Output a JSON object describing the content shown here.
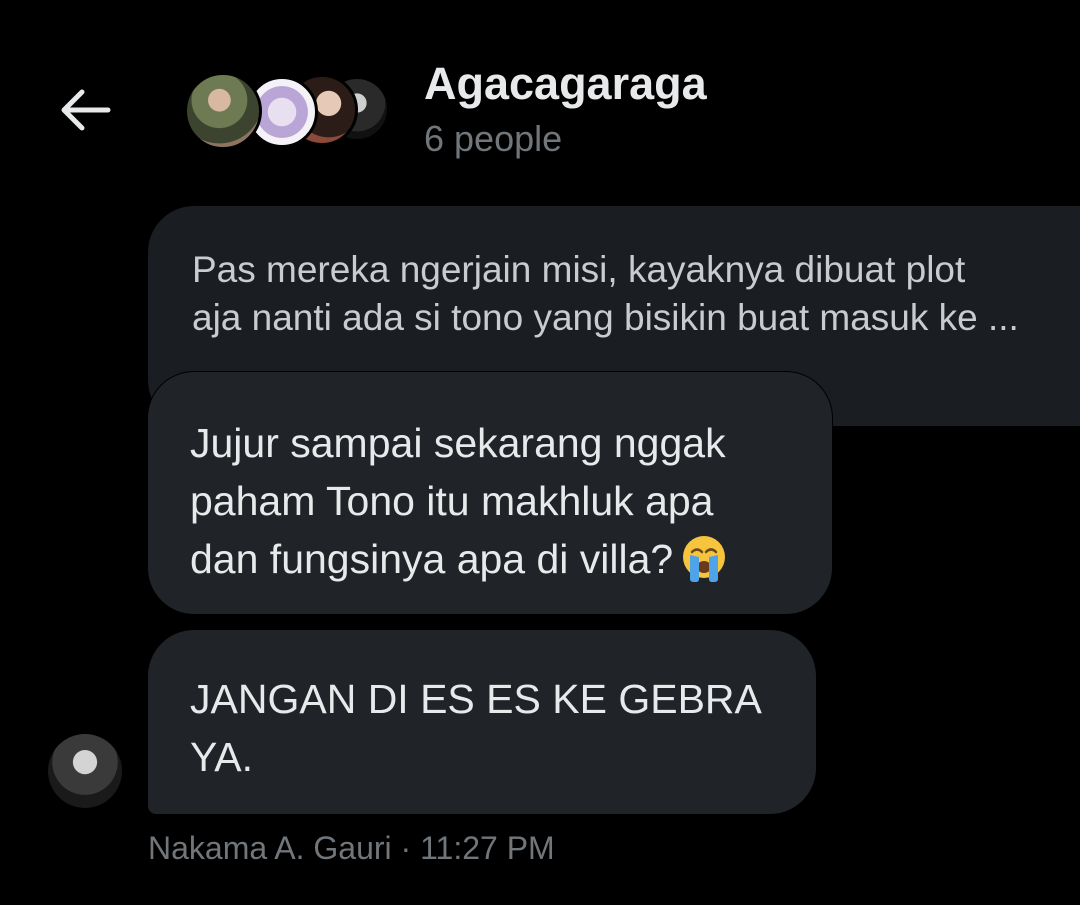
{
  "header": {
    "back_icon": "arrow-left-icon",
    "group_name": "Agacagaraga",
    "member_count": "6 people"
  },
  "messages": [
    {
      "lines": [
        "Pas mereka ngerjain misi, kayaknya dibuat plot",
        "aja nanti ada si tono yang bisikin buat masuk ke ..."
      ]
    },
    {
      "lines": [
        "Jujur sampai sekarang nggak",
        "paham Tono itu makhluk apa",
        "dan fungsinya apa di villa?"
      ],
      "emoji": "loudly-crying-face-icon"
    },
    {
      "lines": [
        "JANGAN DI ES ES KE GEBRA",
        "YA."
      ]
    }
  ],
  "meta": {
    "sender": "Nakama A. Gauri",
    "separator": " · ",
    "time": "11:27 PM"
  },
  "colors": {
    "background": "#000000",
    "bubble": "#202327",
    "text": "#e7e9ea",
    "muted": "#71767b"
  }
}
